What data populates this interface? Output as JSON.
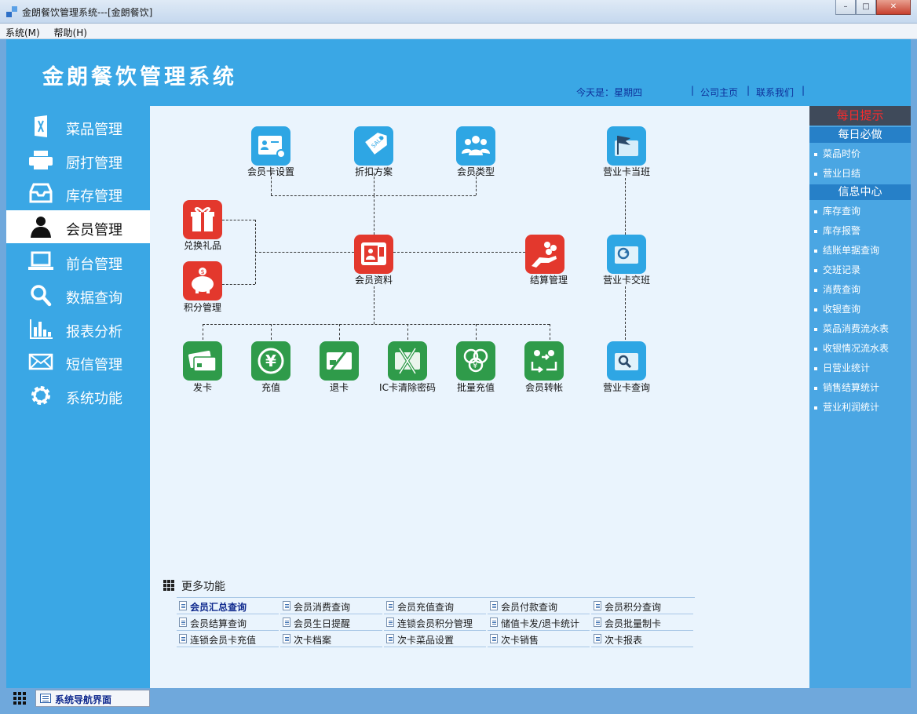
{
  "window": {
    "title": "金朗餐饮管理系统---[金朗餐饮]",
    "minimize_glyph": "–",
    "maximize_glyph": "□",
    "close_glyph": "✕"
  },
  "menu": [
    "系统(M)",
    "帮助(H)"
  ],
  "header": {
    "app_title": "金朗餐饮管理系统",
    "today": "今天是：星期四",
    "separator": "|",
    "links": [
      "公司主页",
      "联系我们"
    ]
  },
  "nav": [
    {
      "label": "菜品管理",
      "icon": "dish-icon"
    },
    {
      "label": "厨打管理",
      "icon": "printer-icon"
    },
    {
      "label": "库存管理",
      "icon": "inbox-icon"
    },
    {
      "label": "会员管理",
      "icon": "user-icon",
      "active": true
    },
    {
      "label": "前台管理",
      "icon": "laptop-icon"
    },
    {
      "label": "数据查询",
      "icon": "search-icon"
    },
    {
      "label": "报表分析",
      "icon": "bar-chart-icon"
    },
    {
      "label": "短信管理",
      "icon": "envelope-icon"
    },
    {
      "label": "系统功能",
      "icon": "gear-icon"
    }
  ],
  "tiles": {
    "card_settings": "会员卡设置",
    "discount_plan": "折扣方案",
    "member_type": "会员类型",
    "shift_on": "营业卡当班",
    "gift_exchange": "兑换礼品",
    "points_mgmt": "积分管理",
    "member_info": "会员资料",
    "settlement": "结算管理",
    "shift_handover": "营业卡交班",
    "issue_card": "发卡",
    "recharge": "充值",
    "refund_card": "退卡",
    "ic_clear": "IC卡清除密码",
    "batch_recharge": "批量充值",
    "member_transfer": "会员转帐",
    "shift_query": "营业卡查询"
  },
  "more": {
    "title": "更多功能",
    "items": [
      "会员汇总查询",
      "会员消费查询",
      "会员充值查询",
      "会员付款查询",
      "会员积分查询",
      "会员结算查询",
      "会员生日提醒",
      "连锁会员积分管理",
      "储值卡发/退卡统计",
      "会员批量制卡",
      "连锁会员卡充值",
      "次卡档案",
      "次卡菜品设置",
      "次卡销售",
      "次卡报表"
    ]
  },
  "right": {
    "header": "每日提示",
    "section1": "每日必做",
    "daily": [
      "菜品时价",
      "营业日结"
    ],
    "section2": "信息中心",
    "info": [
      "库存查询",
      "库存报警",
      "结账单据查询",
      "交班记录",
      "消费查询",
      "收银查询",
      "菜品消费流水表",
      "收银情况流水表",
      "日营业统计",
      "销售结算统计",
      "营业利润统计"
    ]
  },
  "bottom": {
    "tab": "系统导航界面"
  }
}
